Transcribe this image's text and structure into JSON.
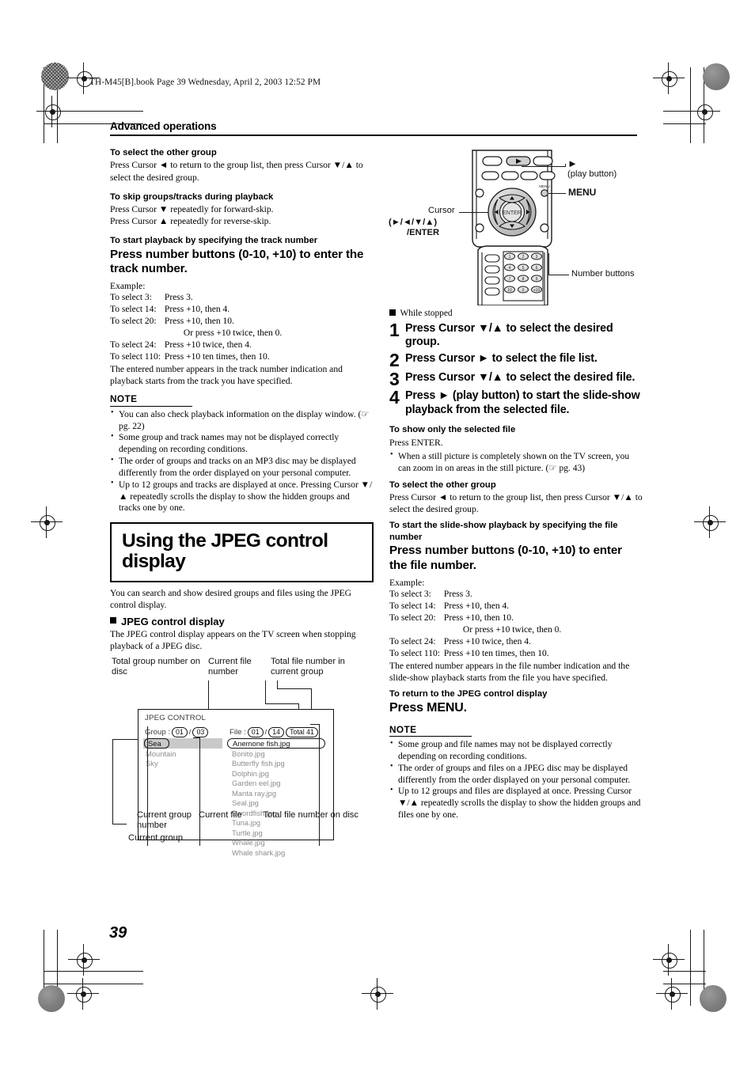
{
  "page": {
    "file_header": "TH-M45[B].book  Page 39  Wednesday, April 2, 2003  12:52 PM",
    "section_title": "Advanced operations",
    "page_number": "39"
  },
  "left_column": {
    "sec1": {
      "heading": "To select the other group",
      "body": "Press Cursor ◄ to return to the group list, then press Cursor ▼/▲ to select the desired group."
    },
    "sec2": {
      "heading": "To skip groups/tracks during playback",
      "line1": "Press Cursor ▼ repeatedly for forward-skip.",
      "line2": "Press Cursor ▲ repeatedly for reverse-skip."
    },
    "sec3": {
      "heading": "To start playback by specifying the track number",
      "big_instruction": "Press number buttons (0-10, +10) to enter the track number.",
      "example_label": "Example:",
      "examples": [
        {
          "k": "To select 3:",
          "v": "Press 3."
        },
        {
          "k": "To select 14:",
          "v": "Press +10, then 4."
        },
        {
          "k": "To select 20:",
          "v": "Press +10, then 10."
        },
        {
          "k": "",
          "v": "Or press +10 twice, then 0."
        },
        {
          "k": "To select 24:",
          "v": "Press +10 twice, then 4."
        },
        {
          "k": "To select 110:",
          "v": "Press +10 ten times, then 10."
        }
      ],
      "closing": "The entered number appears in the track number indication and playback starts from the track you have specified."
    },
    "note": {
      "heading": "NOTE",
      "items": [
        "You can also check playback information on the display window. (☞ pg. 22)",
        "Some group and track names may not be displayed correctly depending on recording conditions.",
        "The order of groups and tracks on an MP3 disc may be displayed differently from the order displayed on your personal computer.",
        "Up to 12 groups and tracks are displayed at once. Pressing Cursor ▼/▲ repeatedly scrolls the display to show the hidden groups and tracks one by one."
      ]
    },
    "title_box": "Using the JPEG control display",
    "intro": "You can search and show desired groups and files using the JPEG control display.",
    "jpeg_display": {
      "heading": "JPEG control display",
      "body": "The JPEG control display appears on the TV screen when stopping playback of a JPEG disc."
    }
  },
  "figure": {
    "callouts": {
      "total_group_number": "Total group number on disc",
      "current_file_number": "Current file number",
      "total_file_in_group": "Total file number in current group",
      "current_group_number": "Current group number",
      "current_file": "Current file",
      "total_file_on_disc": "Total file number on disc",
      "current_group": "Current group"
    },
    "screen": {
      "title": "JPEG CONTROL",
      "group_label": "Group :",
      "group_current": "01",
      "group_sep": "/",
      "group_total": "03",
      "file_label": "File :",
      "file_current": "01",
      "file_sep": "/",
      "file_in_group": "14",
      "file_total": "Total 41",
      "groups_selected": "Sea",
      "groups": [
        "Mountain",
        "Sky"
      ],
      "file_selected": "Anemone fish.jpg",
      "files": [
        "Bonito.jpg",
        "Butterfly fish.jpg",
        "Dolphin.jpg",
        "Garden eel.jpg",
        "Manta ray.jpg",
        "Seal.jpg",
        "Swordfish.jpg",
        "Tuna.jpg",
        "Turtle.jpg",
        "Whale.jpg",
        "Whale shark.jpg"
      ]
    }
  },
  "remote": {
    "labels": {
      "play_symbol": "►",
      "play_button": "(play button)",
      "menu": "MENU",
      "cursor": "Cursor",
      "cursor_dirs": "(►/◄/▼/▲)",
      "cursor_enter": "/ENTER",
      "number_buttons": "Number buttons",
      "enter_center": "ENTER",
      "menu_small": "MENU"
    },
    "keypad": [
      "1",
      "2",
      "3",
      "4",
      "5",
      "6",
      "7",
      "8",
      "9",
      "10",
      "0",
      "+10"
    ]
  },
  "right_column": {
    "while_stopped": "While stopped",
    "steps": [
      {
        "n": "1",
        "t": "Press Cursor ▼/▲ to select the desired group."
      },
      {
        "n": "2",
        "t": "Press Cursor ► to select the file list."
      },
      {
        "n": "3",
        "t": "Press Cursor ▼/▲ to select the desired file."
      },
      {
        "n": "4",
        "t": "Press ► (play button) to start the slide-show playback from the selected file."
      }
    ],
    "sec_show_only": {
      "heading": "To show only the selected file",
      "body": "Press ENTER.",
      "bullet": "When a still picture is completely shown on the TV screen, you can zoom in on areas in the still picture. (☞ pg. 43)"
    },
    "sec_other_group": {
      "heading": "To select the other group",
      "body": "Press Cursor ◄ to return to the group list, then press Cursor ▼/▲ to select the desired group."
    },
    "sec_slideshow": {
      "heading": "To start the slide-show playback by specifying the file number",
      "big_instruction": "Press number buttons (0-10, +10) to enter the file number.",
      "example_label": "Example:",
      "examples": [
        {
          "k": "To select 3:",
          "v": "Press 3."
        },
        {
          "k": "To select 14:",
          "v": "Press +10, then 4."
        },
        {
          "k": "To select 20:",
          "v": "Press +10, then 10."
        },
        {
          "k": "",
          "v": "Or press +10 twice, then 0."
        },
        {
          "k": "To select 24:",
          "v": "Press +10 twice, then 4."
        },
        {
          "k": "To select 110:",
          "v": "Press +10 ten times, then 10."
        }
      ],
      "closing": "The entered number appears in the file number indication and the slide-show playback starts from the file you have specified."
    },
    "sec_return": {
      "heading": "To return to the JPEG control display",
      "big_instruction": "Press MENU."
    },
    "note": {
      "heading": "NOTE",
      "items": [
        "Some group and file names may not be displayed correctly depending on recording conditions.",
        "The order of groups and files on a JPEG disc may be displayed differently from the order displayed on your personal computer.",
        "Up to 12 groups and files are displayed at once. Pressing Cursor ▼/▲ repeatedly scrolls the display to show the hidden groups and files one by one."
      ]
    }
  }
}
